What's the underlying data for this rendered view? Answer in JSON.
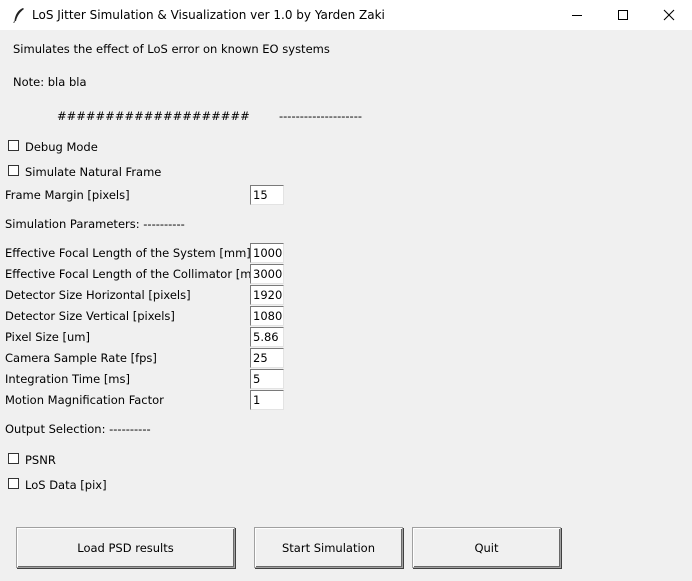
{
  "window": {
    "title": "LoS Jitter Simulation & Visualization ver 1.0  by Yarden Zaki"
  },
  "intro": {
    "description": "Simulates the effect of LoS error on known EO systems",
    "note": "Note: bla bla",
    "hash_separator": "####################",
    "dash_separator": "--------------------"
  },
  "options": {
    "debug_mode": {
      "label": "Debug Mode",
      "checked": false
    },
    "simulate_natural_frame": {
      "label": "Simulate Natural Frame",
      "checked": false
    },
    "frame_margin": {
      "label": "Frame Margin [pixels]",
      "value": "15"
    }
  },
  "simulation": {
    "header": "Simulation Parameters:  ----------",
    "params": [
      {
        "label": "Effective Focal Length of the System [mm]",
        "value": "1000"
      },
      {
        "label": "Effective Focal Length of the Collimator [mm]",
        "value": "3000"
      },
      {
        "label": "Detector Size Horizontal [pixels]",
        "value": "1920"
      },
      {
        "label": "Detector Size Vertical [pixels]",
        "value": "1080"
      },
      {
        "label": "Pixel Size [um]",
        "value": "5.86"
      },
      {
        "label": "Camera Sample Rate [fps]",
        "value": "25"
      },
      {
        "label": "Integration Time [ms]",
        "value": "5"
      },
      {
        "label": "Motion Magnification Factor",
        "value": "1"
      }
    ]
  },
  "output": {
    "header": "Output Selection:  ----------",
    "psnr": {
      "label": "PSNR",
      "checked": false
    },
    "los_data": {
      "label": "LoS Data [pix]",
      "checked": false
    }
  },
  "buttons": {
    "load_psd": "Load PSD results",
    "start": "Start Simulation",
    "quit": "Quit"
  }
}
